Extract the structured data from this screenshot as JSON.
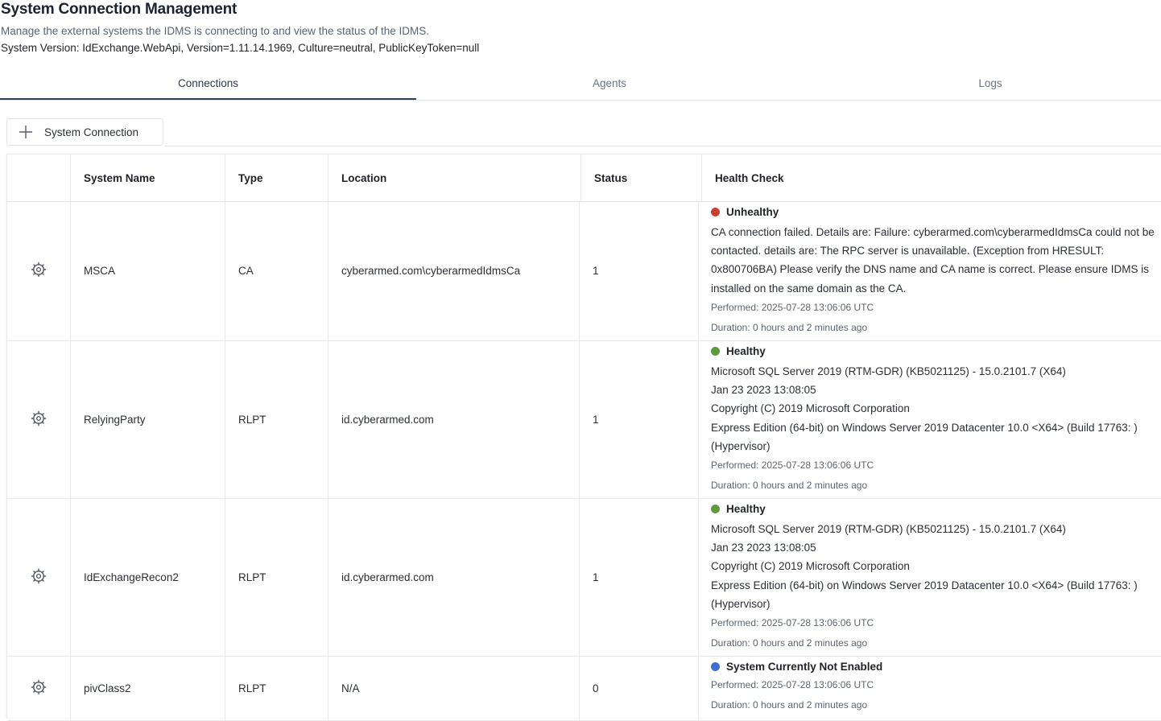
{
  "page": {
    "title": "System Connection Management",
    "subtitle": "Manage the external systems the IDMS is connecting to and view the status of the IDMS.",
    "version": "System Version: IdExchange.WebApi, Version=1.11.14.1969, Culture=neutral, PublicKeyToken=null"
  },
  "tabs": [
    {
      "label": "Connections",
      "active": true
    },
    {
      "label": "Agents",
      "active": false
    },
    {
      "label": "Logs",
      "active": false
    }
  ],
  "toolbar": {
    "add_label": "System Connection",
    "add_icon": "plus-icon"
  },
  "table": {
    "columns": [
      "",
      "System Name",
      "Type",
      "Location",
      "Status",
      "Health Check"
    ],
    "rows": [
      {
        "name": "MSCA",
        "type": "CA",
        "location": "cyberarmed.com\\cyberarmedIdmsCa",
        "status": "1",
        "health": {
          "label": "Unhealthy",
          "color": "#c8412f",
          "detail": [
            "CA connection failed. Details are: Failure: cyberarmed.com\\cyberarmedIdmsCa could not be contacted. details are: The RPC server is unavailable. (Exception from HRESULT: 0x800706BA) Please verify the DNS name and CA name is correct. Please ensure IDMS is installed on the same domain as the CA."
          ],
          "performed": "Performed: 2025-07-28 13:06:06 UTC",
          "duration": "Duration: 0 hours and 2 minutes ago"
        }
      },
      {
        "name": "RelyingParty",
        "type": "RLPT",
        "location": "id.cyberarmed.com",
        "status": "1",
        "health": {
          "label": "Healthy",
          "color": "#5e9a3c",
          "detail": [
            "Microsoft SQL Server 2019 (RTM-GDR) (KB5021125) - 15.0.2101.7 (X64)",
            "Jan 23 2023 13:08:05",
            "Copyright (C) 2019 Microsoft Corporation",
            "Express Edition (64-bit) on Windows Server 2019 Datacenter 10.0 <X64> (Build 17763: ) (Hypervisor)"
          ],
          "performed": "Performed: 2025-07-28 13:06:06 UTC",
          "duration": "Duration: 0 hours and 2 minutes ago"
        }
      },
      {
        "name": "IdExchangeRecon2",
        "type": "RLPT",
        "location": "id.cyberarmed.com",
        "status": "1",
        "health": {
          "label": "Healthy",
          "color": "#5e9a3c",
          "detail": [
            "Microsoft SQL Server 2019 (RTM-GDR) (KB5021125) - 15.0.2101.7 (X64)",
            "Jan 23 2023 13:08:05",
            "Copyright (C) 2019 Microsoft Corporation",
            "Express Edition (64-bit) on Windows Server 2019 Datacenter 10.0 <X64> (Build 17763: ) (Hypervisor)"
          ],
          "performed": "Performed: 2025-07-28 13:06:06 UTC",
          "duration": "Duration: 0 hours and 2 minutes ago"
        }
      },
      {
        "name": "pivClass2",
        "type": "RLPT",
        "location": "N/A",
        "status": "0",
        "health": {
          "label": "System Currently Not Enabled",
          "color": "#3d6fd1",
          "detail": [],
          "performed": "Performed: 2025-07-28 13:06:06 UTC",
          "duration": "Duration: 0 hours and 2 minutes ago"
        }
      }
    ]
  },
  "icons": {
    "row_action": "gear-icon",
    "add": "plus-icon"
  }
}
